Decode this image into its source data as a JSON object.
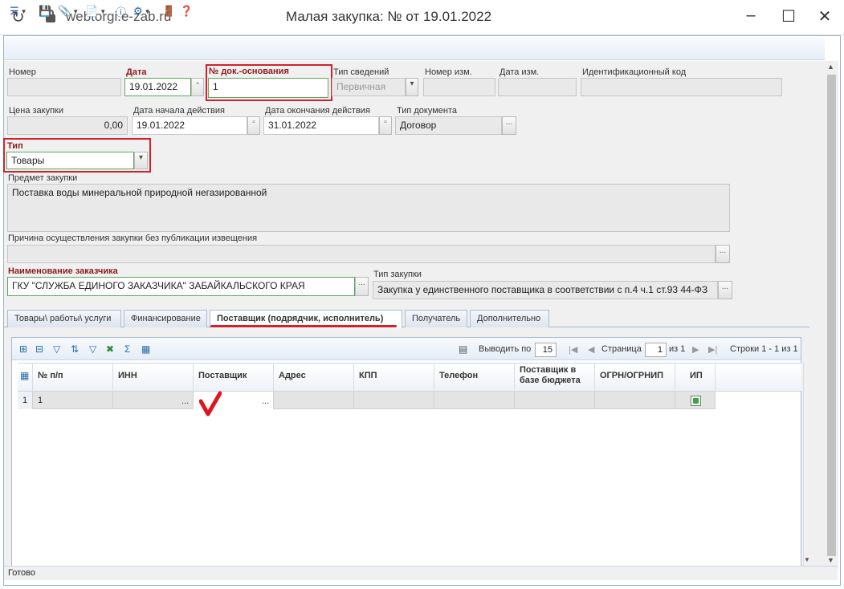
{
  "browser": {
    "url": "webtorgi.e-zab.ru",
    "title": "Малая закупка: № от 19.01.2022"
  },
  "toolbar": {
    "icons": [
      "actions-icon",
      "save-icon",
      "attach-icon",
      "document-icon",
      "info-icon",
      "link-icon",
      "exit-icon",
      "help-icon"
    ]
  },
  "form": {
    "nomer": {
      "label": "Номер",
      "value": ""
    },
    "data": {
      "label": "Дата",
      "value": "19.01.2022"
    },
    "doc_osn": {
      "label": "№ док.-основания",
      "value": "1"
    },
    "tip_svedeniy": {
      "label": "Тип сведений",
      "value": "Первичная"
    },
    "nomer_izm": {
      "label": "Номер изм.",
      "value": ""
    },
    "data_izm": {
      "label": "Дата изм.",
      "value": ""
    },
    "ident_kod": {
      "label": "Идентификационный код",
      "value": ""
    },
    "cena": {
      "label": "Цена закупки",
      "value": "0,00"
    },
    "data_nach": {
      "label": "Дата начала действия",
      "value": "19.01.2022"
    },
    "data_okon": {
      "label": "Дата окончания действия",
      "value": "31.01.2022"
    },
    "tip_doc": {
      "label": "Тип документа",
      "value": "Договор"
    },
    "tip": {
      "label": "Тип",
      "value": "Товары"
    },
    "predmet": {
      "label": "Предмет закупки",
      "value": "Поставка воды минеральной природной негазированной"
    },
    "prichina": {
      "label": "Причина осуществления закупки без публикации извещения",
      "value": ""
    },
    "zakazchik": {
      "label": "Наименование заказчика",
      "value": "ГКУ \"СЛУЖБА ЕДИНОГО ЗАКАЗЧИКА\" ЗАБАЙКАЛЬСКОГО КРАЯ"
    },
    "tip_zakupki": {
      "label": "Тип закупки",
      "value": "Закупка у единственного поставщика в соответствии с п.4 ч.1 ст.93 44-ФЗ"
    },
    "ellipsis": "..."
  },
  "tabs": [
    {
      "label": "Товары\\ работы\\ услуги"
    },
    {
      "label": "Финансирование"
    },
    {
      "label": "Поставщик (подрядчик, исполнитель)"
    },
    {
      "label": "Получатель"
    },
    {
      "label": "Дополнительно"
    }
  ],
  "pager": {
    "per_page_label": "Выводить по",
    "per_page": "15",
    "page_label": "Страница",
    "page": "1",
    "of_label": "из 1",
    "rows_label": "Строки 1 - 1 из 1"
  },
  "grid": {
    "columns": [
      "№ п/п",
      "ИНН",
      "Поставщик",
      "Адрес",
      "КПП",
      "Телефон",
      "Поставщик в базе бюджета",
      "ОГРН/ОГРНИП",
      "ИП"
    ],
    "rows": [
      {
        "index": "1",
        "num": "1",
        "inn": "",
        "supplier": "",
        "ip": true
      }
    ]
  },
  "status": "Готово",
  "colors": {
    "required": "#8a1c1c",
    "highlight": "#d0222c",
    "valid": "#5aa85a"
  }
}
